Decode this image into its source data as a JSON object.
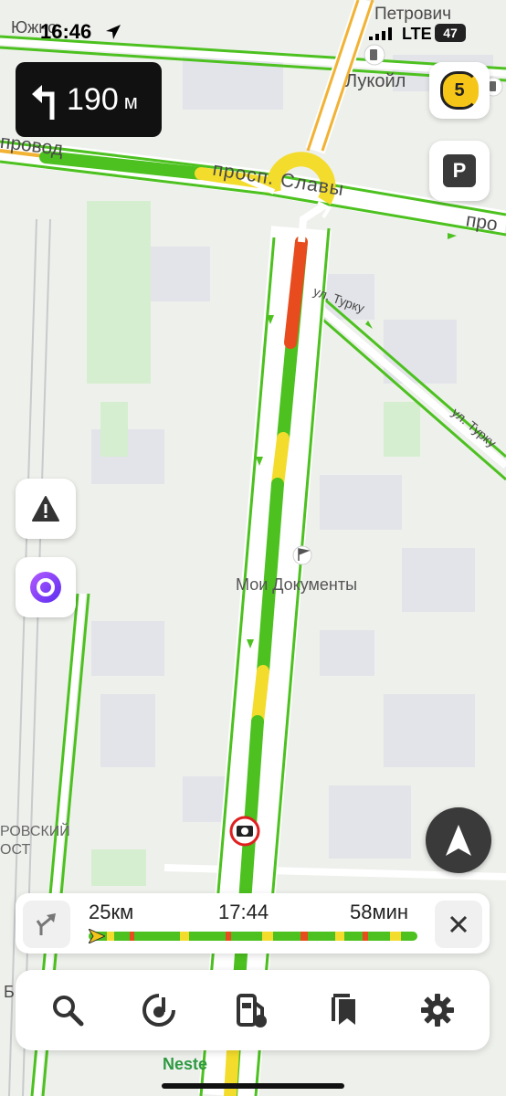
{
  "status_bar": {
    "time": "16:46",
    "network": "LTE",
    "battery": "47"
  },
  "maneuver": {
    "distance": "190",
    "unit": "м",
    "direction": "turn-left-icon"
  },
  "map_labels": {
    "top_left_street": "Южно",
    "top_right_street": "Петрович",
    "station": "Лукойл",
    "left_street": "провод",
    "main_avenue": "просп. Славы",
    "main_avenue_right": "про",
    "street_turku_1": "ул. Турку",
    "street_turku_2": "ул. Турку",
    "poi": "Мои Документы",
    "district_1": "РОВСКИЙ",
    "district_2": "ОСТ",
    "bottom_left": "Б",
    "bottom_poi": "Neste"
  },
  "side_buttons": {
    "traffic_level": "5",
    "parking": "P"
  },
  "route_panel": {
    "distance": "25км",
    "arrival": "17:44",
    "duration": "58мин"
  },
  "colors": {
    "route_green": "#4cc11f",
    "route_yellow": "#f3dc2c",
    "route_red": "#e84b1d",
    "accent_purple": "#7b2cf0"
  }
}
